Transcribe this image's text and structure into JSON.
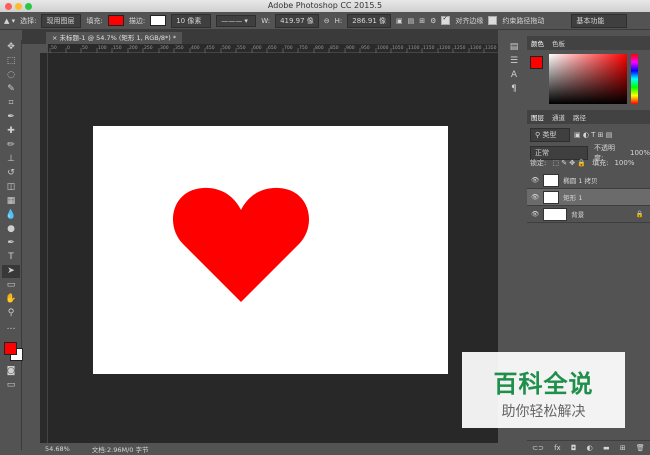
{
  "app": {
    "title": "Adobe Photoshop CC 2015.5"
  },
  "options_bar": {
    "select_label": "选择:",
    "select_value": "现用图层",
    "fill_label": "填充:",
    "stroke_label": "描边:",
    "stroke_width": "10 像素",
    "w_label": "W:",
    "w_value": "419.97 像",
    "h_label": "H:",
    "h_value": "286.91 像",
    "align_edges_label": "对齐边缘",
    "constrain_path_label": "约束路径拖动",
    "workspace": "基本功能",
    "fill_color": "#ff0000",
    "align_edges_checked": true,
    "constrain_path_checked": false
  },
  "document": {
    "tab_label": "未标题-1 @ 54.7% (矩形 1, RGB/8*) *",
    "canvas_color": "#ffffff",
    "shape_color": "#ff0000",
    "shape": "heart"
  },
  "status": {
    "zoom": "54.68%",
    "doc_info": "文档:2.96M/0 字节"
  },
  "color_panel": {
    "tabs": [
      "颜色",
      "色板"
    ],
    "foreground": "#ff0000",
    "background": "#ffffff"
  },
  "layers_panel": {
    "tabs": [
      "图层",
      "通道",
      "路径"
    ],
    "filter_label": "类型",
    "blend_mode": "正常",
    "opacity_label": "不透明度:",
    "opacity_value": "100%",
    "lock_label": "锁定:",
    "fill_label": "填充:",
    "fill_value": "100%",
    "layers": [
      {
        "name": "椭圆 1 拷贝",
        "visible": true,
        "selected": false
      },
      {
        "name": "矩形 1",
        "visible": true,
        "selected": true
      },
      {
        "name": "背景",
        "visible": true,
        "selected": false,
        "locked": true
      }
    ]
  },
  "ruler_ticks": [
    "50",
    "0",
    "50",
    "100",
    "150",
    "200",
    "250",
    "300",
    "350",
    "400",
    "450",
    "500",
    "550",
    "600",
    "650",
    "700",
    "750",
    "800",
    "850",
    "900",
    "950",
    "1000",
    "1050",
    "1100",
    "1150",
    "1200",
    "1250",
    "1300",
    "1350"
  ],
  "watermark": {
    "title": "百科全说",
    "subtitle": "助你轻松解决"
  }
}
